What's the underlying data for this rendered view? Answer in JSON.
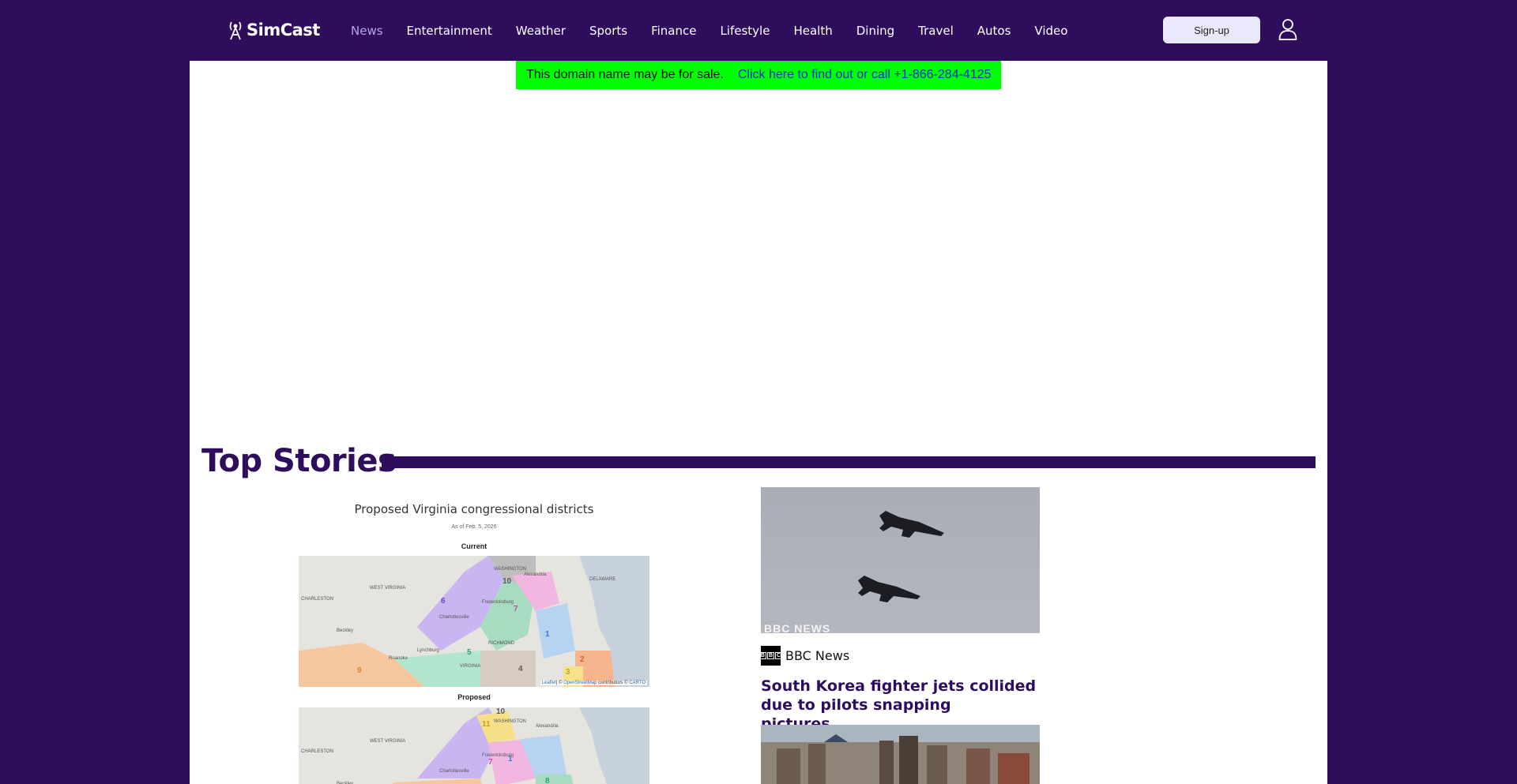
{
  "header": {
    "brand": "SimCast",
    "nav": [
      {
        "label": "News",
        "active": true
      },
      {
        "label": "Entertainment"
      },
      {
        "label": "Weather"
      },
      {
        "label": "Sports"
      },
      {
        "label": "Finance"
      },
      {
        "label": "Lifestyle"
      },
      {
        "label": "Health"
      },
      {
        "label": "Dining"
      },
      {
        "label": "Travel"
      },
      {
        "label": "Autos"
      },
      {
        "label": "Video"
      }
    ],
    "signup_label": "Sign-up",
    "user_icon": "user-icon"
  },
  "banner": {
    "text": "This domain name may be for sale.",
    "link": "Click here to find out or call +1-866-284-4125"
  },
  "top_stories": {
    "heading": "Top Stories",
    "map_story": {
      "title": "Proposed Virginia congressional districts",
      "date": "As of Feb. 5, 2026",
      "current_label": "Current",
      "proposed_label": "Proposed",
      "attribution_leaflet": "Leaflet",
      "attribution_mid": "| © ",
      "attribution_osm": "OpenStreetMap",
      "attribution_contrib": " contributors © ",
      "attribution_carto": "CARTO",
      "place_labels": {
        "washington": "WASHINGTON",
        "alexandria": "Alexandria",
        "delaware": "DELAWARE",
        "west_virginia": "WEST VIRGINIA",
        "charleston": "CHARLESTON",
        "beckley": "Beckley",
        "fredericksburg": "Fredericksburg",
        "charlottesville": "Charlottesville",
        "richmond": "RICHMOND",
        "lynchburg": "Lynchburg",
        "roanoke": "Roanoke",
        "virginia": "VIRGINIA"
      },
      "current_districts": [
        "10",
        "6",
        "7",
        "1",
        "5",
        "4",
        "2",
        "9",
        "3"
      ],
      "proposed_districts": [
        "10",
        "11",
        "7",
        "1",
        "8"
      ]
    },
    "jets_story": {
      "image_watermark": "BBC NEWS",
      "source_name": "BBC News",
      "source_logo_letters": [
        "B",
        "B",
        "C"
      ],
      "headline": "South Korea fighter jets collided due to pilots snapping pictures,..."
    }
  },
  "colors": {
    "brand_purple": "#2e0e5c",
    "banner_green": "#00ff00",
    "active_nav": "#b7a6e8"
  }
}
